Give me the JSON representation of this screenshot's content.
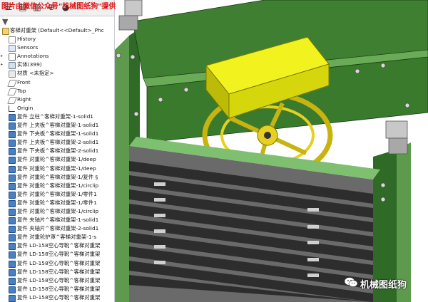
{
  "watermark": {
    "top_text": "图片由微信公众号\"机械图纸狗\"提供",
    "bottom_text": "机械图纸狗"
  },
  "tabs": [
    {
      "icon": "feature-manager-icon"
    },
    {
      "icon": "property-manager-icon"
    },
    {
      "icon": "configuration-manager-icon"
    },
    {
      "icon": "dimxpert-icon"
    },
    {
      "icon": "display-manager-icon"
    }
  ],
  "tree": {
    "root": "客梯对重架 (Default<<Default>_Phc",
    "items": [
      {
        "label": "History",
        "icon": "history-icon",
        "cls": "i-hist"
      },
      {
        "label": "Sensors",
        "icon": "sensor-icon",
        "cls": "i-sens"
      },
      {
        "label": "Annotations",
        "icon": "annotations-icon",
        "cls": "i-ann",
        "exp": "▸"
      },
      {
        "label": "实体(399)",
        "icon": "solid-bodies-icon",
        "cls": "i-solid",
        "exp": "▸"
      },
      {
        "label": "材质 <未指定>",
        "icon": "material-icon",
        "cls": "i-mat"
      },
      {
        "label": "Front",
        "icon": "plane-icon",
        "cls": "i-plane"
      },
      {
        "label": "Top",
        "icon": "plane-icon",
        "cls": "i-plane"
      },
      {
        "label": "Right",
        "icon": "plane-icon",
        "cls": "i-plane"
      },
      {
        "label": "Origin",
        "icon": "origin-icon",
        "cls": "i-orig"
      },
      {
        "label": "复件 立柱^客梯对重架-1-solid1",
        "icon": "part-icon",
        "cls": "i-part"
      },
      {
        "label": "复件 上夹板^客梯对重架-1-solid1",
        "icon": "part-icon",
        "cls": "i-part"
      },
      {
        "label": "复件 下夹板^客梯对重架-1-solid1",
        "icon": "part-icon",
        "cls": "i-part"
      },
      {
        "label": "复件 上夹板^客梯对重架-2-solid1",
        "icon": "part-icon",
        "cls": "i-part"
      },
      {
        "label": "复件 下夹板^客梯对重架-2-solid1",
        "icon": "part-icon",
        "cls": "i-part"
      },
      {
        "label": "复件 对重轮^客梯对重架-1/deep",
        "icon": "part-icon",
        "cls": "i-part"
      },
      {
        "label": "复件 对重轮^客梯对重架-1/deep",
        "icon": "part-icon",
        "cls": "i-part"
      },
      {
        "label": "复件 对重轮^客梯对重架-1/复件 §",
        "icon": "part-icon",
        "cls": "i-part"
      },
      {
        "label": "复件 对重轮^客梯对重架-1/circlip",
        "icon": "part-icon",
        "cls": "i-part"
      },
      {
        "label": "复件 对重轮^客梯对重架-1/零件1",
        "icon": "part-icon",
        "cls": "i-part"
      },
      {
        "label": "复件 对重轮^客梯对重架-1/零件1",
        "icon": "part-icon",
        "cls": "i-part"
      },
      {
        "label": "复件 对重轮^客梯对重架-1/circlip",
        "icon": "part-icon",
        "cls": "i-part"
      },
      {
        "label": "复件 夹轴片^客梯对重架-1-solid1",
        "icon": "part-icon",
        "cls": "i-part"
      },
      {
        "label": "复件 夹轴片^客梯对重架-2-solid1",
        "icon": "part-icon",
        "cls": "i-part"
      },
      {
        "label": "复件 对重轮护罩^客梯对重架-1-s",
        "icon": "part-icon",
        "cls": "i-part"
      },
      {
        "label": "复件 LD-158空心导靴^客梯对重架",
        "icon": "part-icon",
        "cls": "i-part"
      },
      {
        "label": "复件 LD-158空心导靴^客梯对重架",
        "icon": "part-icon",
        "cls": "i-part"
      },
      {
        "label": "复件 LD-158空心导靴^客梯对重架",
        "icon": "part-icon",
        "cls": "i-part"
      },
      {
        "label": "复件 LD-158空心导靴^客梯对重架",
        "icon": "part-icon",
        "cls": "i-part"
      },
      {
        "label": "复件 LD-158空心导靴^客梯对重架",
        "icon": "part-icon",
        "cls": "i-part"
      },
      {
        "label": "复件 LD-158空心导靴^客梯对重架",
        "icon": "part-icon",
        "cls": "i-part"
      },
      {
        "label": "复件 LD-158空心导靴^客梯对重架",
        "icon": "part-icon",
        "cls": "i-part"
      }
    ]
  },
  "viewport": {
    "toolbar_icons": [
      "zoom-fit-icon",
      "zoom-area-icon",
      "previous-view-icon",
      "section-view-icon",
      "view-orientation-icon",
      "display-style-icon",
      "hide-show-icon",
      "edit-appearance-icon",
      "apply-scene-icon",
      "view-settings-icon"
    ]
  }
}
